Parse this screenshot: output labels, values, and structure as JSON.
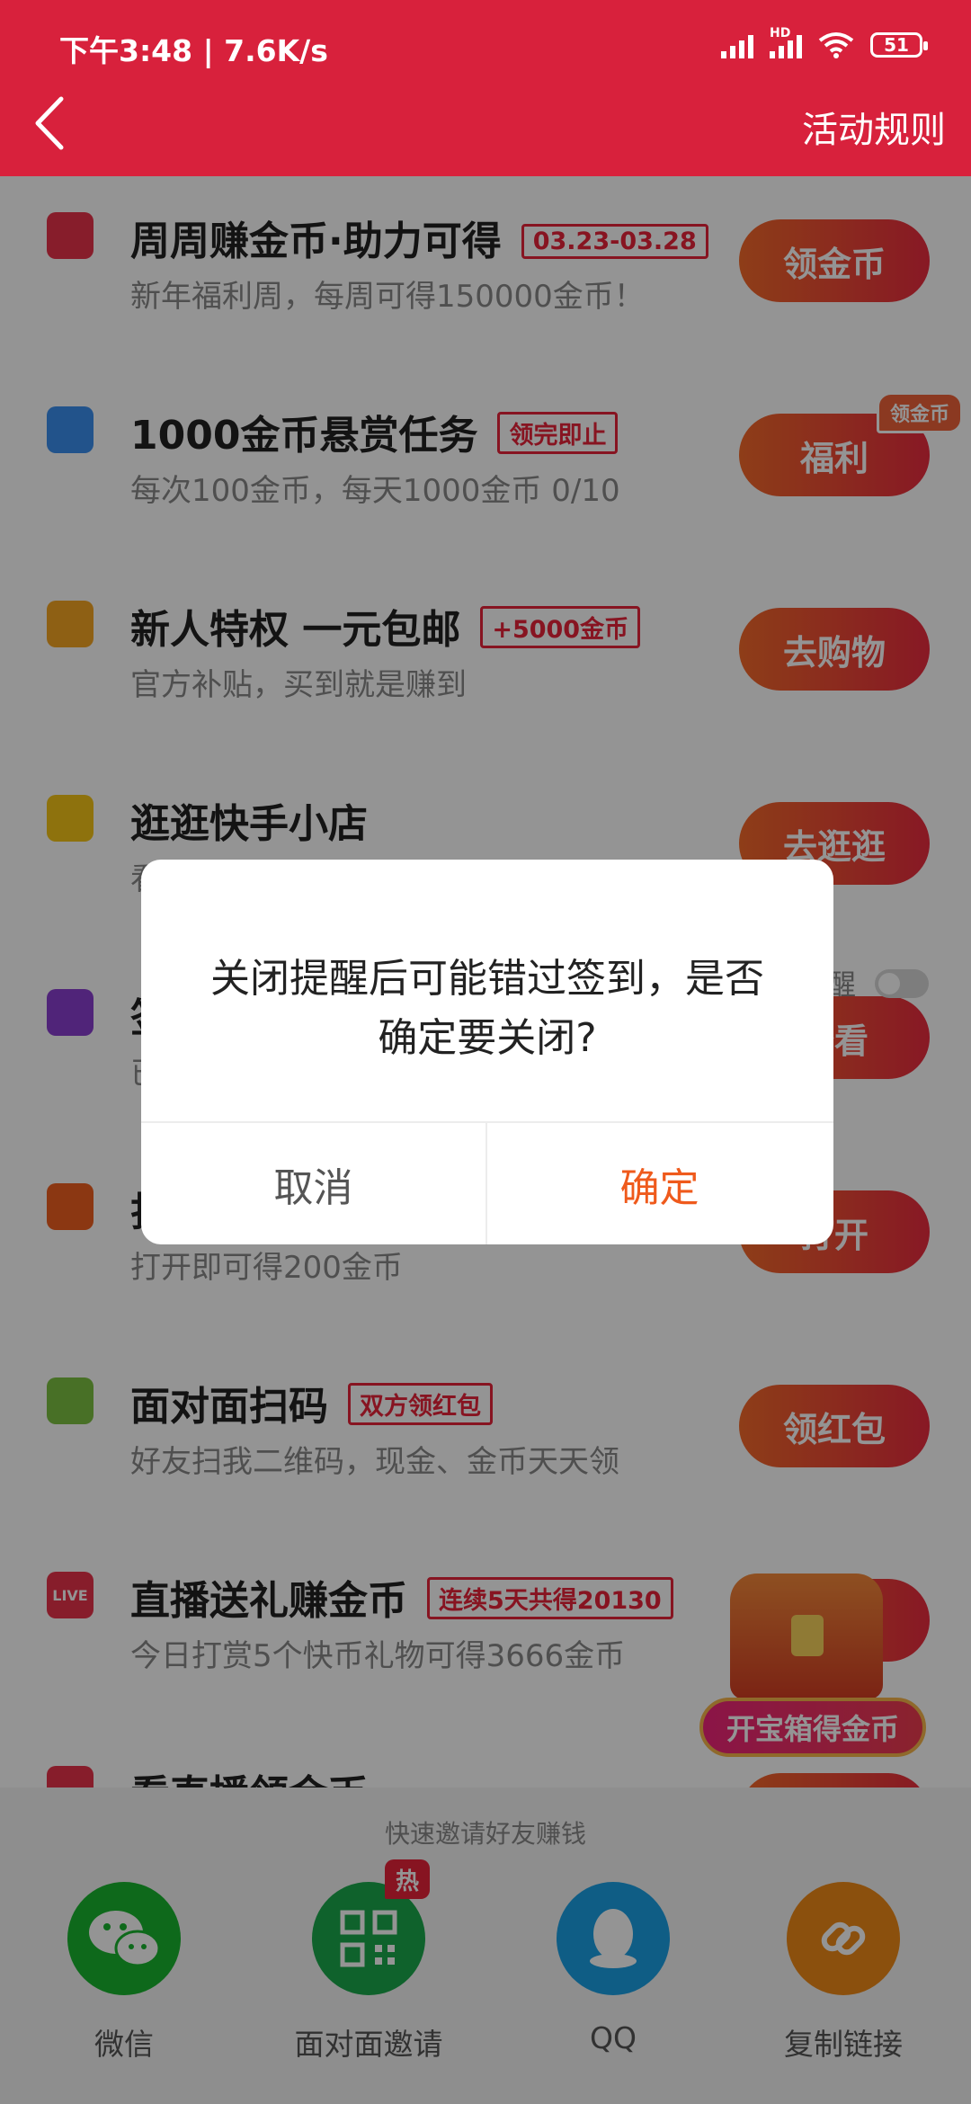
{
  "status_bar": {
    "time": "下午3:48 | 7.6K/s",
    "hd": "HD",
    "battery": "51"
  },
  "header": {
    "rules_label": "活动规则"
  },
  "tasks": [
    {
      "title": "周周赚金币·助力可得",
      "tag": "03.23-03.28",
      "subtitle": "新年福利周，每周可得150000金币！",
      "button": "领金币",
      "icon_color": "#e8334a"
    },
    {
      "title": "1000金币悬赏任务",
      "tag": "领完即止",
      "subtitle": "每次100金币，每天1000金币 0/10",
      "button": "福利",
      "badge": "领金币",
      "icon_color": "#3b8ff0"
    },
    {
      "title": "新人特权 一元包邮",
      "tag": "+5000金币",
      "subtitle": "官方补贴，买到就是赚到",
      "button": "去购物",
      "icon_color": "#f5a623"
    },
    {
      "title": "逛逛快手小店",
      "subtitle": "看",
      "button": "去逛逛",
      "icon_color": "#f5c518"
    },
    {
      "title": "签",
      "subtitle": "已",
      "button": "查看",
      "toggle_label": "醒",
      "icon_color": "#8a3fd1"
    },
    {
      "title": "打",
      "subtitle": "打开即可得200金币",
      "button": "打开",
      "icon_color": "#f06020"
    },
    {
      "title": "面对面扫码",
      "tag": "双方领红包",
      "subtitle": "好友扫我二维码，现金、金币天天领",
      "button": "领红包",
      "icon_color": "#7cc242"
    },
    {
      "title": "直播送礼赚金币",
      "tag": "连续5天共得20130",
      "subtitle": "今日打赏5个快币礼物可得3666金币",
      "button": "",
      "icon_color": "#e8334a",
      "icon_text": "LIVE"
    },
    {
      "title": "看直播领金币",
      "subtitle": "",
      "button": "",
      "icon_color": "#e8334a"
    }
  ],
  "treasure": {
    "label": "开宝箱得金币"
  },
  "share": {
    "caption": "快速邀请好友赚钱",
    "items": [
      {
        "label": "微信",
        "color": "#19b52f"
      },
      {
        "label": "面对面邀请",
        "color": "#1aa94c",
        "hot": "热"
      },
      {
        "label": "QQ",
        "color": "#1aa0e5"
      },
      {
        "label": "复制链接",
        "color": "#f08a18"
      }
    ]
  },
  "dialog": {
    "message": "关闭提醒后可能错过签到，是否确定要关闭?",
    "cancel": "取消",
    "confirm": "确定"
  }
}
